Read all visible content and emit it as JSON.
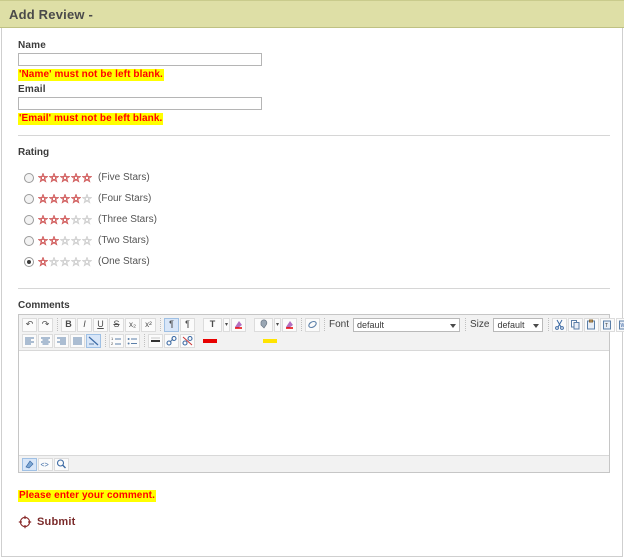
{
  "header": {
    "title": "Add Review -",
    "bg_color": "#dedfa6",
    "text_color": "#4a4a4a"
  },
  "form": {
    "name": {
      "label": "Name",
      "value": "",
      "placeholder": "",
      "error": "'Name' must not be left blank."
    },
    "email": {
      "label": "Email",
      "value": "",
      "placeholder": "",
      "error": "'Email' must not be left blank."
    },
    "error_colors": {
      "background": "#ffff00",
      "text": "#ff0000"
    }
  },
  "rating": {
    "label": "Rating",
    "selected_index": 4,
    "options": [
      {
        "label": "(Five Stars)",
        "filled": 5,
        "total": 5,
        "checked": false
      },
      {
        "label": "(Four Stars)",
        "filled": 4,
        "total": 5,
        "checked": false
      },
      {
        "label": "(Three Stars)",
        "filled": 3,
        "total": 5,
        "checked": false
      },
      {
        "label": "(Two Stars)",
        "filled": 2,
        "total": 5,
        "checked": false
      },
      {
        "label": "(One Stars)",
        "filled": 1,
        "total": 5,
        "checked": true
      }
    ],
    "star_filled_color": "#d05a5a",
    "star_empty_color": "#cfcfcf"
  },
  "comments": {
    "label": "Comments",
    "value": "",
    "error": "Please enter your comment."
  },
  "editor": {
    "toolbar_row1": [
      {
        "name": "undo-icon",
        "glyph": "↶",
        "type": "button"
      },
      {
        "name": "redo-icon",
        "glyph": "↷",
        "type": "button"
      },
      {
        "name": "separator",
        "type": "sep"
      },
      {
        "name": "bold-icon",
        "glyph": "B",
        "type": "button"
      },
      {
        "name": "italic-icon",
        "glyph": "I",
        "type": "button"
      },
      {
        "name": "underline-icon",
        "glyph": "U",
        "type": "button"
      },
      {
        "name": "strikethrough-icon",
        "glyph": "S",
        "type": "button"
      },
      {
        "name": "subscript-icon",
        "glyph": "x₂",
        "type": "button"
      },
      {
        "name": "superscript-icon",
        "glyph": "x²",
        "type": "button"
      },
      {
        "name": "separator",
        "type": "sep"
      },
      {
        "name": "ltr-direction-icon",
        "glyph": "¶",
        "type": "button",
        "active": true
      },
      {
        "name": "rtl-direction-icon",
        "glyph": "¶",
        "type": "button"
      }
    ],
    "toolbar_row2": [
      {
        "name": "align-left-icon",
        "type": "button"
      },
      {
        "name": "align-center-icon",
        "type": "button"
      },
      {
        "name": "align-right-icon",
        "type": "button"
      },
      {
        "name": "align-justify-icon",
        "type": "button"
      },
      {
        "name": "remove-format-icon",
        "type": "button",
        "active": true
      },
      {
        "name": "separator",
        "type": "sep"
      },
      {
        "name": "ordered-list-icon",
        "type": "button"
      },
      {
        "name": "unordered-list-icon",
        "type": "button"
      },
      {
        "name": "separator",
        "type": "sep"
      },
      {
        "name": "horizontal-rule-icon",
        "type": "button"
      },
      {
        "name": "insert-link-icon",
        "type": "button"
      },
      {
        "name": "unlink-icon",
        "type": "button"
      }
    ],
    "text_color": {
      "button_name": "text-color-icon",
      "glyph": "T",
      "swatch_color": "#e80000",
      "dropdown_name": "text-color-dropdown",
      "picker_name": "text-color-picker-icon"
    },
    "highlight_color": {
      "button_name": "highlight-color-icon",
      "swatch_color": "#ffe400",
      "dropdown_name": "highlight-color-dropdown",
      "picker_name": "highlight-color-picker-icon"
    },
    "eraser": {
      "name": "remove-styles-icon"
    },
    "font": {
      "label": "Font",
      "value": "default"
    },
    "size": {
      "label": "Size",
      "value": "default"
    },
    "clipboard": [
      {
        "name": "cut-icon"
      },
      {
        "name": "copy-icon"
      },
      {
        "name": "paste-icon"
      },
      {
        "name": "paste-text-icon"
      },
      {
        "name": "paste-word-icon"
      }
    ],
    "indent": [
      {
        "name": "decrease-indent-icon"
      },
      {
        "name": "increase-indent-icon"
      }
    ],
    "media": [
      {
        "name": "insert-image-icon"
      }
    ],
    "status_bar": [
      {
        "name": "design-mode-icon"
      },
      {
        "name": "source-code-icon"
      },
      {
        "name": "preview-icon"
      }
    ]
  },
  "submit": {
    "label": "Submit",
    "icon": "submit-target-icon",
    "color": "#7a2a2a"
  }
}
